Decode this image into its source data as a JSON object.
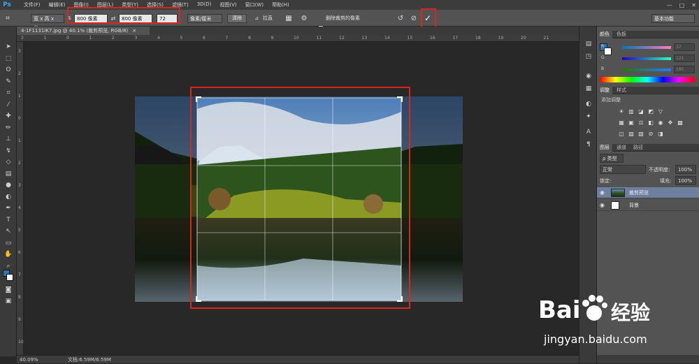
{
  "app": {
    "logo": "Ps"
  },
  "menu": [
    "文件(F)",
    "编辑(E)",
    "图像(I)",
    "图层(L)",
    "类型(Y)",
    "选择(S)",
    "滤镜(T)",
    "3D(D)",
    "视图(V)",
    "窗口(W)",
    "帮助(H)"
  ],
  "window_controls": [
    "—",
    "□",
    "✕"
  ],
  "options": {
    "ratio_select": "宽 x 高 x 分...",
    "width_value": "800 像素",
    "height_value": "800 像素",
    "resolution_value": "72",
    "units_select": "像素/厘米",
    "clear_label": "清除",
    "straighten_label": "拉直",
    "delete_cropped_label": "删除裁剪的像素",
    "commit_icon": "✓",
    "workspace_label": "基本功能"
  },
  "document_tab": "4-1F1131IK7.jpg @ 40.1% (裁剪预览, RGB/8)",
  "status": {
    "zoom": "40.09%",
    "doc_info": "文档:6.59M/6.59M"
  },
  "color_panel": {
    "tabs": [
      "颜色",
      "色板"
    ],
    "sliders": [
      {
        "label": "R",
        "value": "37"
      },
      {
        "label": "G",
        "value": "121"
      },
      {
        "label": "B",
        "value": "185"
      }
    ],
    "colors": {
      "foreground": "#2579b9",
      "background": "#ffffff"
    }
  },
  "adjustments_panel": {
    "tabs": [
      "调整",
      "样式"
    ],
    "title": "添加调整"
  },
  "layers_panel": {
    "tabs": [
      "图层",
      "通道",
      "路径"
    ],
    "kind_select": "ρ 类型",
    "blend_select": "正常",
    "opacity_label": "不透明度:",
    "opacity_value": "100%",
    "lock_label": "锁定:",
    "fill_label": "填充:",
    "fill_value": "100%",
    "layers": [
      {
        "name": "裁剪预览"
      },
      {
        "name": "背景"
      }
    ]
  },
  "watermark": {
    "brand_left": "Bai",
    "brand_right": "经验",
    "url": "jingyan.baidu.com"
  },
  "ruler_top_numbers": [
    "2",
    "1",
    "0",
    "1",
    "2",
    "3",
    "4",
    "5",
    "6",
    "7",
    "8",
    "9",
    "10",
    "11",
    "12",
    "13",
    "14",
    "15",
    "16",
    "17",
    "18",
    "19",
    "20",
    "21"
  ],
  "ruler_left_numbers": [
    "3",
    "2",
    "1",
    "0",
    "1",
    "2",
    "3",
    "4",
    "5",
    "6",
    "7",
    "8",
    "9",
    "10"
  ]
}
